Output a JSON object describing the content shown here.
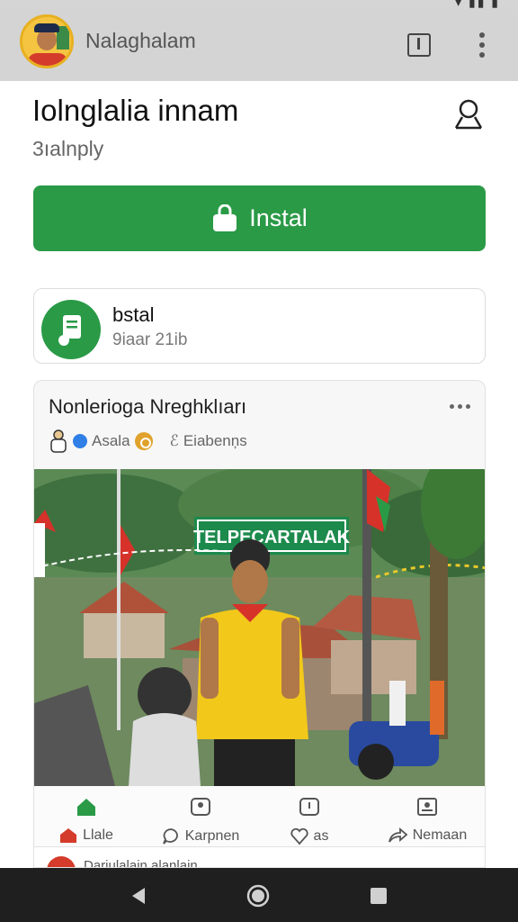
{
  "app_bar": {
    "title": "Nalaghalam"
  },
  "listing": {
    "title": "Iolnglalia  innam",
    "subtitle": "3ıalnply",
    "install_label": "Instal"
  },
  "app_card": {
    "name": "bstal",
    "size": "9iaar 21ib"
  },
  "post": {
    "title": "Nonlerioga Nreghklıarı",
    "author_label": "Asala",
    "meta_label": "Eiabenņs",
    "photo_sign": "TELPECARTALAK",
    "actions": [
      {
        "label": "Llale",
        "icon": "home-icon"
      },
      {
        "label": "Karpnen",
        "icon": "comment-icon"
      },
      {
        "label": "as",
        "icon": "like-icon"
      },
      {
        "label": "Nemaan",
        "icon": "share-icon"
      }
    ]
  },
  "next_post": {
    "text": "Dariulalain alanlain"
  },
  "colors": {
    "accent": "#2a9a46",
    "app_bar": "#d4d4d4",
    "nav_bar": "#1f1f1f"
  }
}
